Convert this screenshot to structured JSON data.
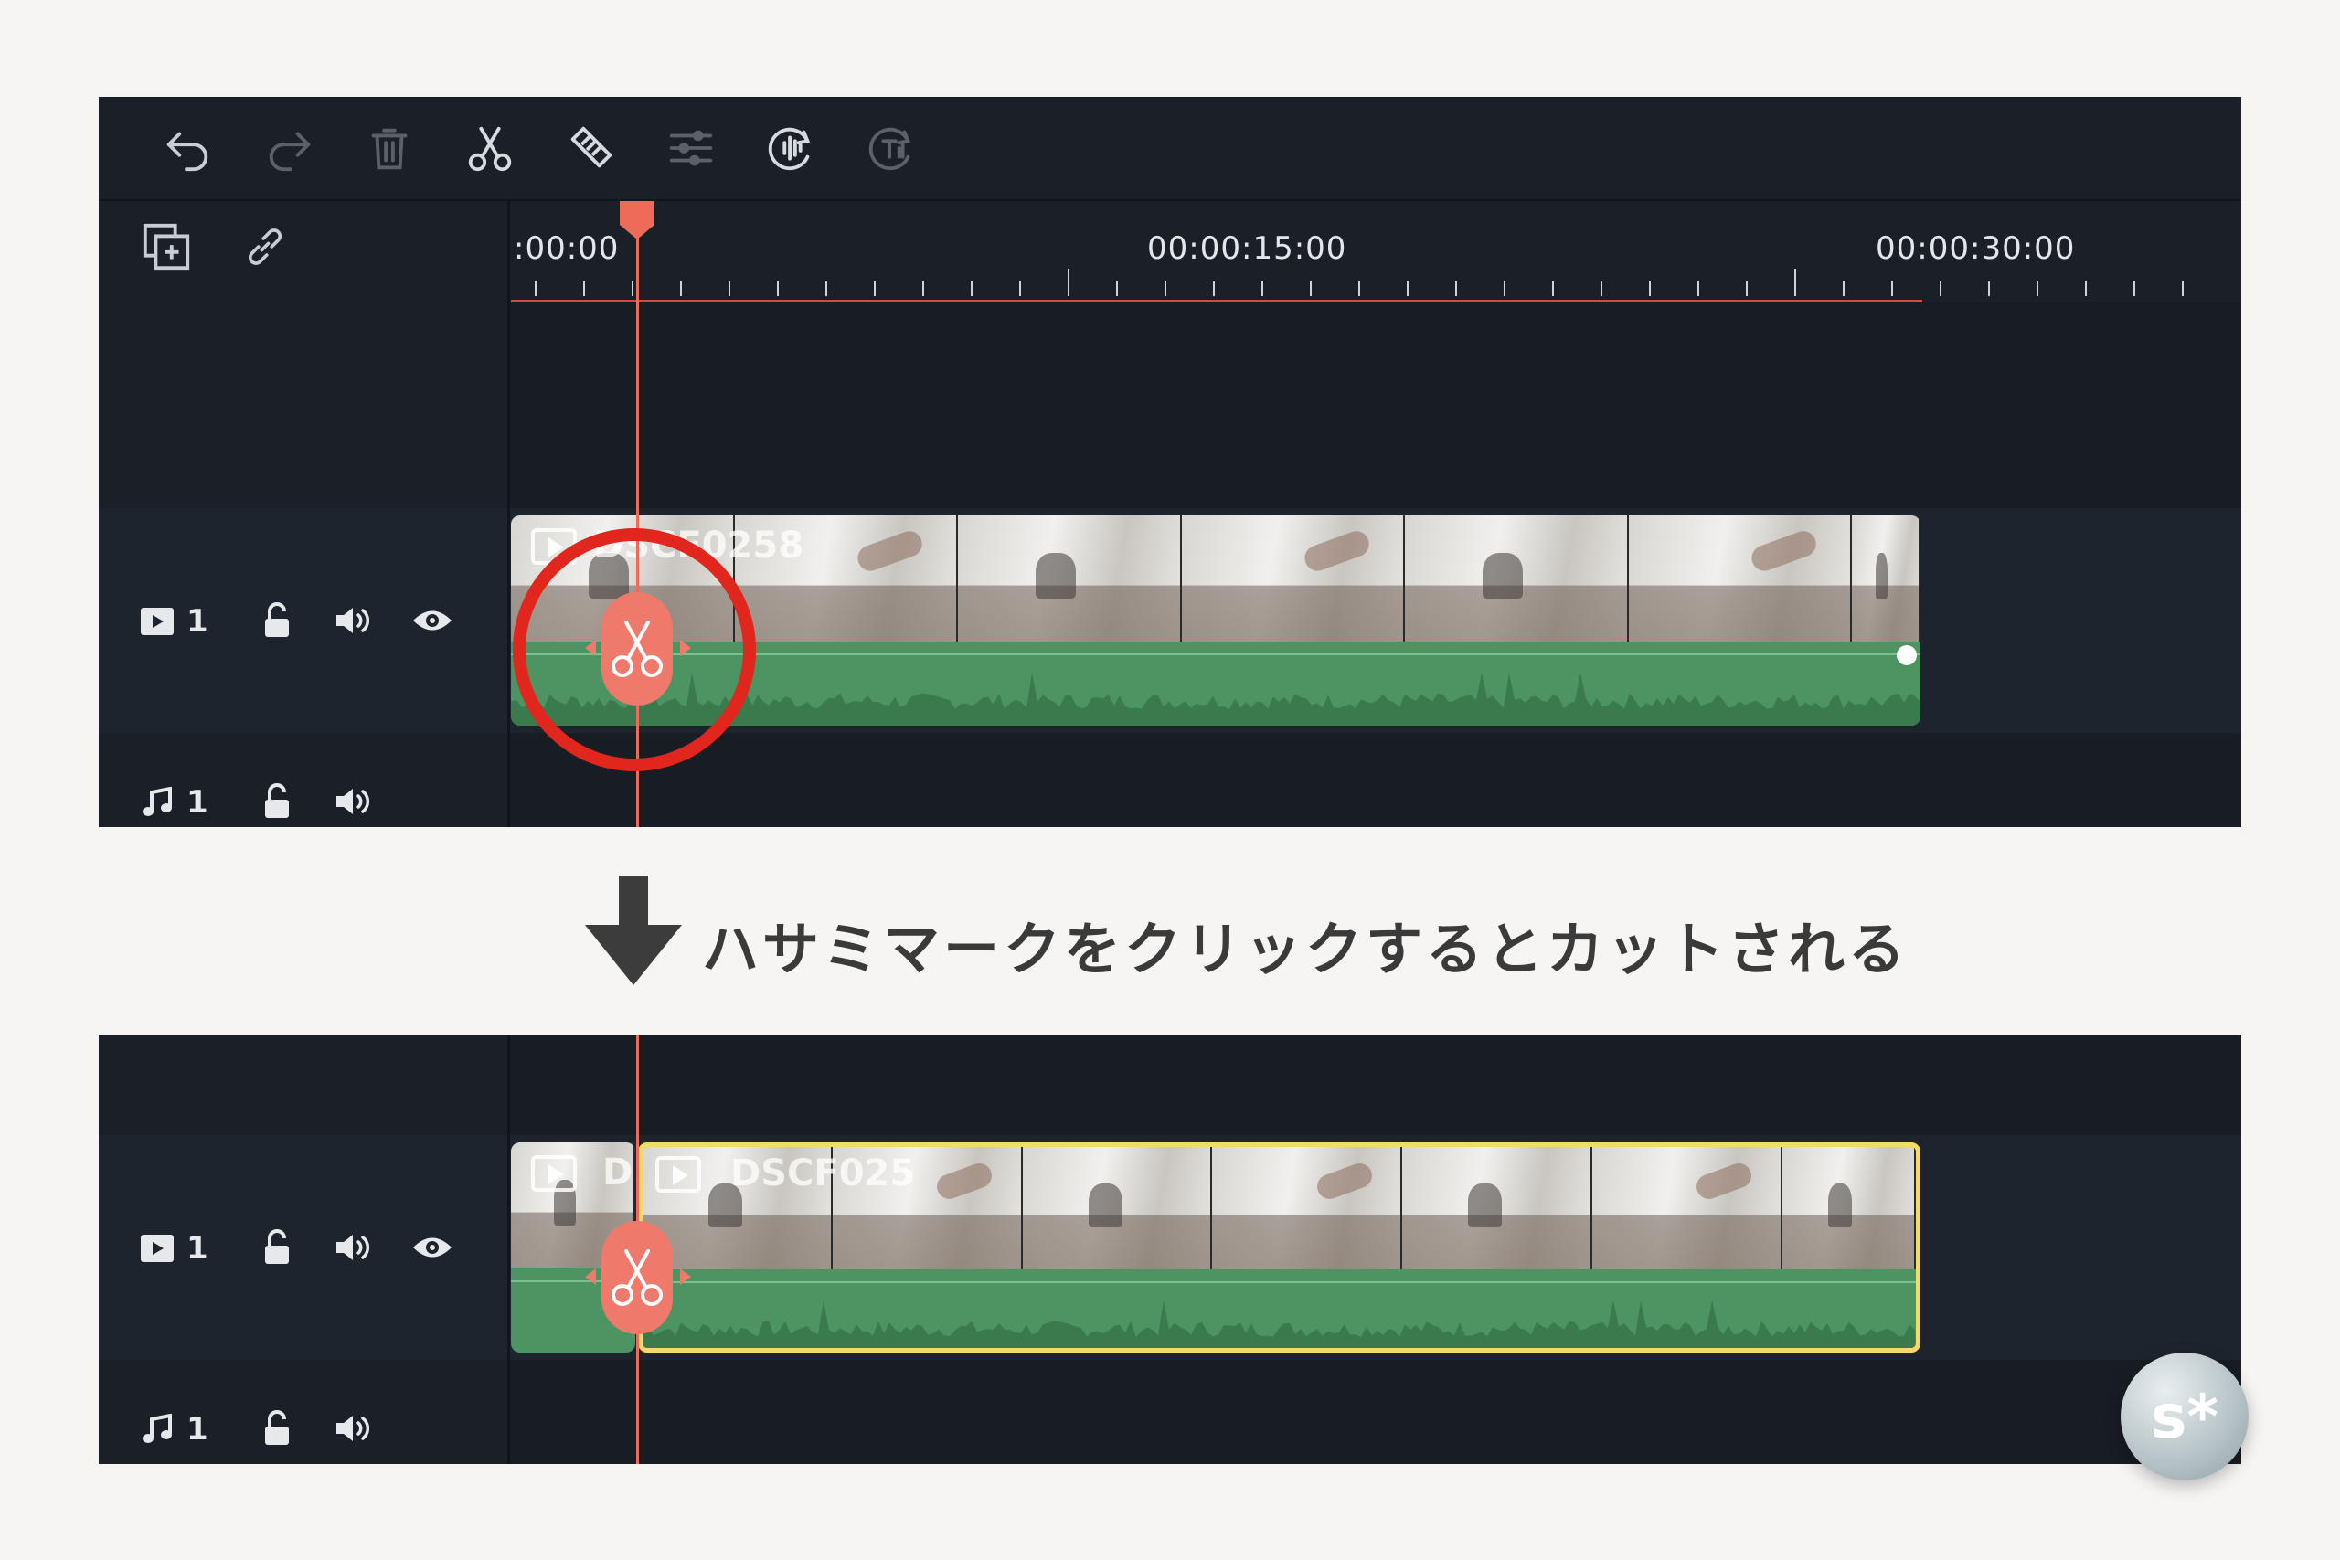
{
  "toolbar": {
    "icons": [
      "undo-icon",
      "redo-icon",
      "delete-icon",
      "scissors-icon",
      "tag-icon",
      "adjust-icon",
      "audio-detect-icon",
      "text-to-speech-icon"
    ]
  },
  "ruler": {
    "labels": [
      ":00:00",
      "00:00:15:00",
      "00:00:30:00"
    ]
  },
  "tracks": {
    "video_label": "1",
    "audio_label": "1"
  },
  "clips": {
    "top_name": "DSCF0258",
    "bottom_left_name": "D",
    "bottom_right_name": "DSCF025"
  },
  "caption": "ハサミマークをクリックするとカットされる",
  "logo_text": "s*",
  "colors": {
    "accent": "#ee6b5a",
    "clip_green": "#4c9461",
    "highlight_red": "#e0261d",
    "selection_yellow": "#f3db6a",
    "panel": "#1a1f27"
  }
}
